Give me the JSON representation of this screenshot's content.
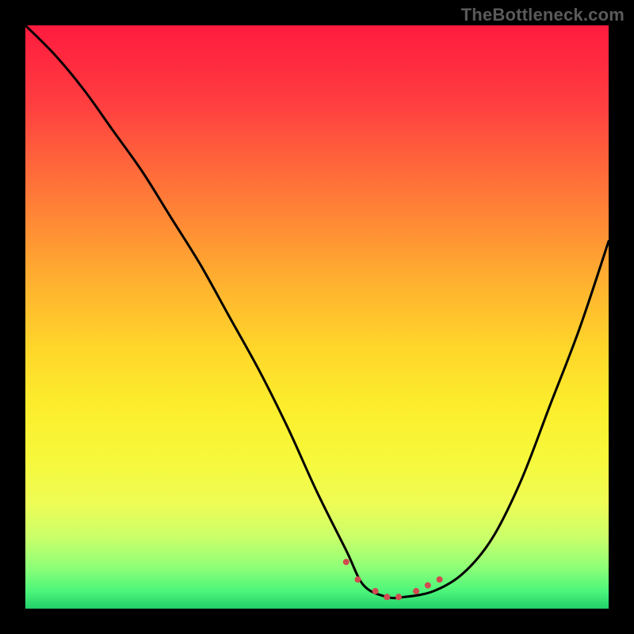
{
  "watermark": "TheBottleneck.com",
  "chart_data": {
    "type": "line",
    "title": "",
    "xlabel": "",
    "ylabel": "",
    "xlim": [
      0,
      100
    ],
    "ylim": [
      0,
      100
    ],
    "grid": false,
    "series": [
      {
        "name": "bottleneck-curve",
        "x": [
          0,
          5,
          10,
          15,
          20,
          25,
          30,
          35,
          40,
          45,
          50,
          55,
          58,
          62,
          65,
          70,
          75,
          80,
          85,
          90,
          95,
          100
        ],
        "values": [
          100,
          95,
          89,
          82,
          75,
          67,
          59,
          50,
          41,
          31,
          20,
          10,
          4,
          2,
          2,
          3,
          6,
          12,
          22,
          35,
          48,
          63
        ]
      }
    ],
    "markers": {
      "name": "optimal-range-markers",
      "x": [
        55,
        57,
        60,
        62,
        64,
        67,
        69,
        71
      ],
      "values": [
        8,
        5,
        3,
        2,
        2,
        3,
        4,
        5
      ],
      "color": "#d14a4f",
      "radius": 4
    },
    "curve_color": "#000000",
    "curve_width": 3
  }
}
